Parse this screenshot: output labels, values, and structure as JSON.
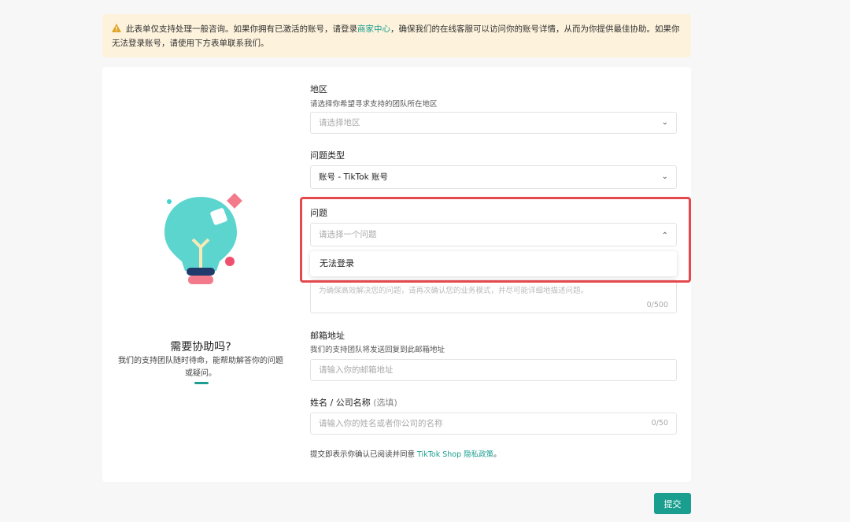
{
  "banner": {
    "text_before": "此表单仅支持处理一般咨询。如果你拥有已激活的账号，请登录",
    "link": "商家中心",
    "text_after": "，确保我们的在线客服可以访问你的账号详情，从而为你提供最佳协助。如果你无法登录账号，请使用下方表单联系我们。"
  },
  "left": {
    "title": "需要协助吗?",
    "desc": "我们的支持团队随时待命，能帮助解答你的问题或疑问。"
  },
  "form": {
    "region": {
      "label": "地区",
      "sub": "请选择你希望寻求支持的团队所在地区",
      "placeholder": "请选择地区"
    },
    "issue_type": {
      "label": "问题类型",
      "value": "账号 - TikTok 账号"
    },
    "issue": {
      "label": "问题",
      "placeholder": "请选择一个问题",
      "options": [
        "无法登录"
      ]
    },
    "description": {
      "placeholder": "为确保高效解决您的问题，请再次确认您的业务模式，并尽可能详细地描述问题。",
      "count": "0/500"
    },
    "email": {
      "label": "邮箱地址",
      "sub": "我们的支持团队将发送回复到此邮箱地址",
      "placeholder": "请输入你的邮箱地址"
    },
    "name": {
      "label": "姓名 / 公司名称",
      "optional": "(选填)",
      "placeholder": "请输入你的姓名或者你公司的名称",
      "count": "0/50"
    },
    "disclaimer": {
      "text": "提交即表示你确认已阅读并同意",
      "link": "TikTok Shop 隐私政策",
      "end": "。"
    }
  },
  "submit_label": "提交",
  "colors": {
    "accent": "#1a9e8f",
    "highlight": "#e5484d",
    "banner": "#fdf2dc"
  }
}
